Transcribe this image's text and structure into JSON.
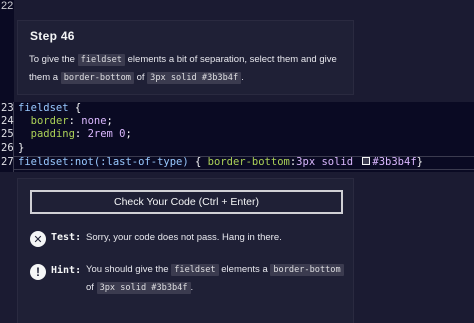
{
  "editor_top": {
    "line_number": "22"
  },
  "description": {
    "step_title": "Step 46",
    "text_1": "To give the ",
    "chip_1": "fieldset",
    "text_2": " elements a bit of separation, select them and give them a ",
    "chip_2": "border-bottom",
    "text_3": " of ",
    "chip_3": "3px solid #3b3b4f",
    "text_4": "."
  },
  "code_editor": {
    "lines": [
      {
        "num": "23",
        "selector": "fieldset",
        "brace": " {"
      },
      {
        "num": "24",
        "indent": "  ",
        "prop": "border",
        "colon": ": ",
        "value": "none",
        "end": ";"
      },
      {
        "num": "25",
        "indent": "  ",
        "prop": "padding",
        "colon": ": ",
        "value": "2rem 0",
        "end": ";"
      },
      {
        "num": "26",
        "brace": "}"
      },
      {
        "num": "27",
        "selector": "fieldset:not(:last-of-type)",
        "open": " { ",
        "prop": "border-bottom",
        "colon": ":",
        "value_a": "3px solid ",
        "value_b": "#3b3b4f",
        "close": "}"
      }
    ],
    "swatch_color": "#3b3b4f"
  },
  "results": {
    "check_button_label": "Check Your Code (Ctrl + Enter)",
    "test_label": "Test:",
    "test_text": "Sorry, your code does not pass. Hang in there.",
    "hint_label": "Hint:",
    "hint_text_1": "You should give the ",
    "hint_chip_1": "fieldset",
    "hint_text_2": " elements a ",
    "hint_chip_2": "border-bottom",
    "hint_text_3": " of ",
    "hint_chip_3": "3px solid #3b3b4f",
    "hint_text_4": "."
  },
  "colors": {
    "background": "#1b1b32",
    "panel": "#1f2036",
    "editor_bg": "#0a0a23",
    "chip_bg": "#3b3b4f",
    "selector": "#99c9ff",
    "property": "#acd157",
    "value": "#dbb8ff"
  },
  "icons": {
    "test_icon": "close-circle-icon",
    "hint_icon": "lightbulb-icon"
  }
}
